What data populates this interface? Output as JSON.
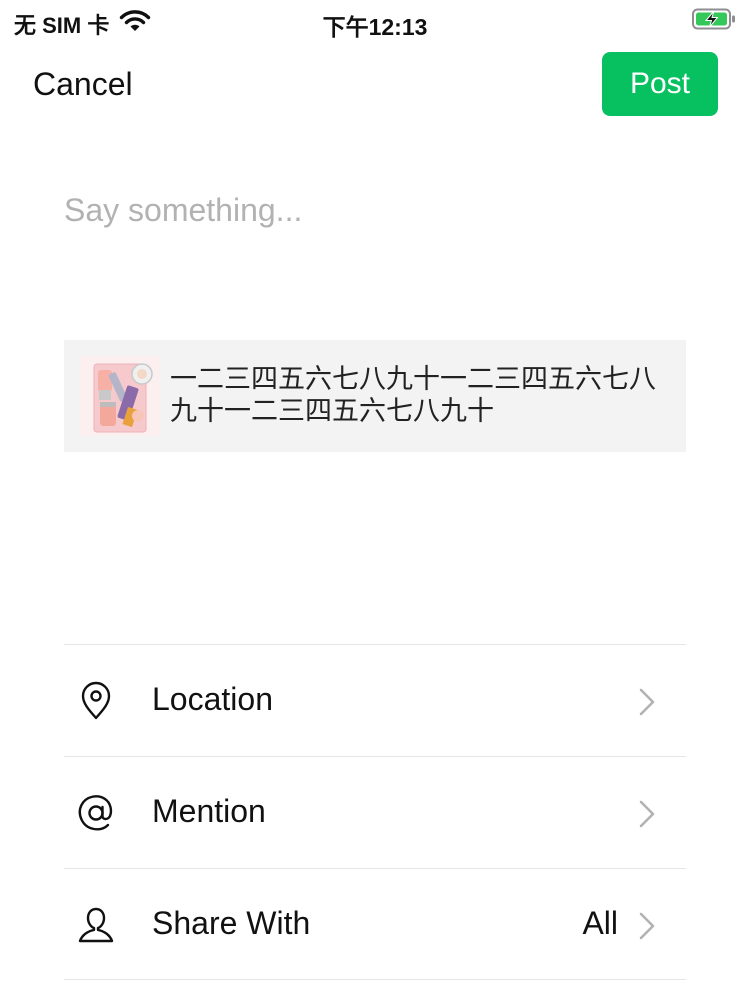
{
  "status_bar": {
    "carrier": "无 SIM 卡",
    "time": "下午12:13"
  },
  "nav": {
    "cancel_label": "Cancel",
    "post_label": "Post",
    "post_color": "#07c160"
  },
  "compose": {
    "placeholder": "Say something...",
    "value": ""
  },
  "share_card": {
    "text": "一二三四五六七八九十一二三四五六七八九十一二三四五六七八九十"
  },
  "options": [
    {
      "label": "Location",
      "value": "",
      "icon": "location-pin-icon"
    },
    {
      "label": "Mention",
      "value": "",
      "icon": "at-sign-icon"
    },
    {
      "label": "Share With",
      "value": "All",
      "icon": "person-icon"
    }
  ]
}
